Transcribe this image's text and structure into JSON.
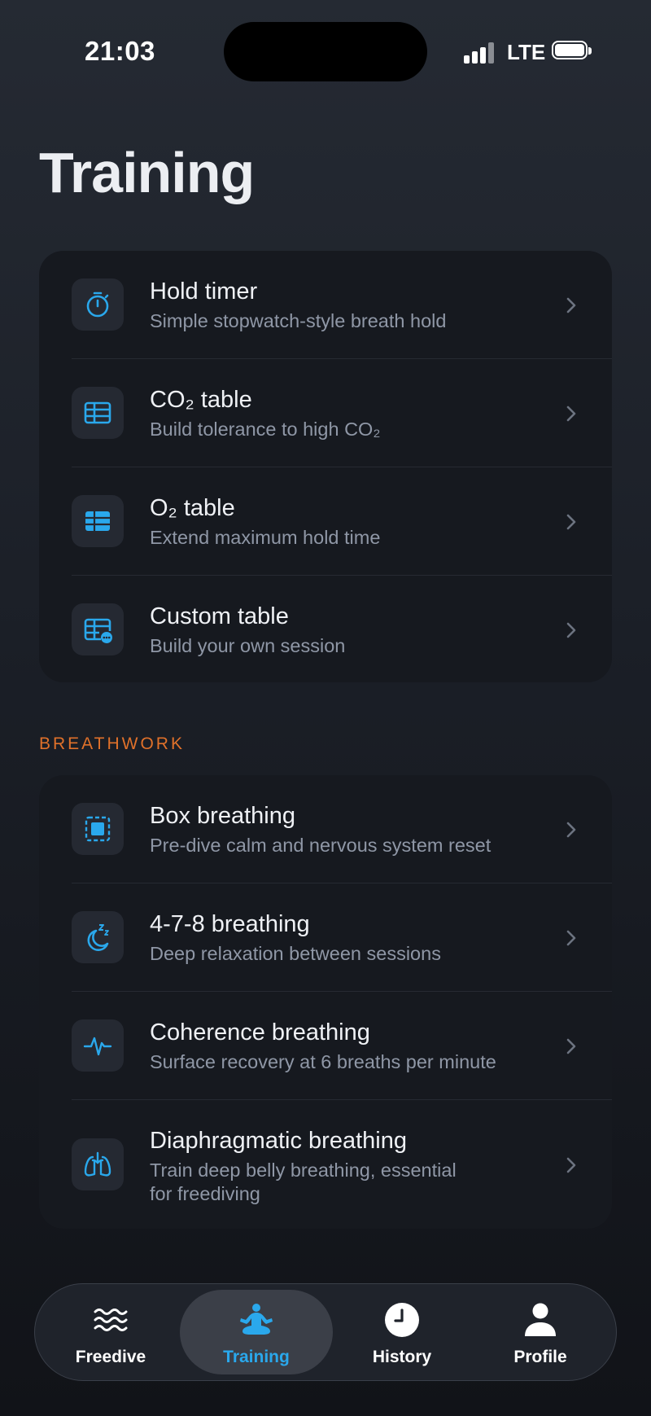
{
  "status_bar": {
    "time": "21:03",
    "network": "LTE"
  },
  "page": {
    "title": "Training"
  },
  "training_items": [
    {
      "title": "Hold timer",
      "subtitle": "Simple stopwatch-style breath hold",
      "icon": "stopwatch-icon"
    },
    {
      "title": "CO₂ table",
      "subtitle": "Build tolerance to high CO₂",
      "icon": "table-icon"
    },
    {
      "title": "O₂ table",
      "subtitle": "Extend maximum hold time",
      "icon": "table-filled-icon"
    },
    {
      "title": "Custom table",
      "subtitle": "Build your own session",
      "icon": "table-ellipsis-icon"
    }
  ],
  "breathwork": {
    "section_label": "BREATHWORK",
    "items": [
      {
        "title": "Box breathing",
        "subtitle": "Pre-dive calm and nervous system reset",
        "icon": "square-target-icon"
      },
      {
        "title": "4-7-8 breathing",
        "subtitle": "Deep relaxation between sessions",
        "icon": "moon-sleep-icon"
      },
      {
        "title": "Coherence breathing",
        "subtitle": "Surface recovery at 6 breaths per minute",
        "icon": "heartbeat-icon"
      },
      {
        "title": "Diaphragmatic breathing",
        "subtitle_line1": "Train deep belly breathing, essential",
        "subtitle_line2": "for freediving",
        "icon": "lungs-icon"
      }
    ]
  },
  "tab_bar": {
    "tabs": [
      {
        "label": "Freedive",
        "icon": "waves-icon",
        "active": false
      },
      {
        "label": "Training",
        "icon": "meditation-icon",
        "active": true
      },
      {
        "label": "History",
        "icon": "clock-icon",
        "active": false
      },
      {
        "label": "Profile",
        "icon": "person-icon",
        "active": false
      }
    ]
  },
  "colors": {
    "accent": "#2aa8ec",
    "section_label": "#e0712a",
    "card_bg": "#16191f",
    "icon_bg": "#252932",
    "subtitle": "#8f97a6"
  }
}
